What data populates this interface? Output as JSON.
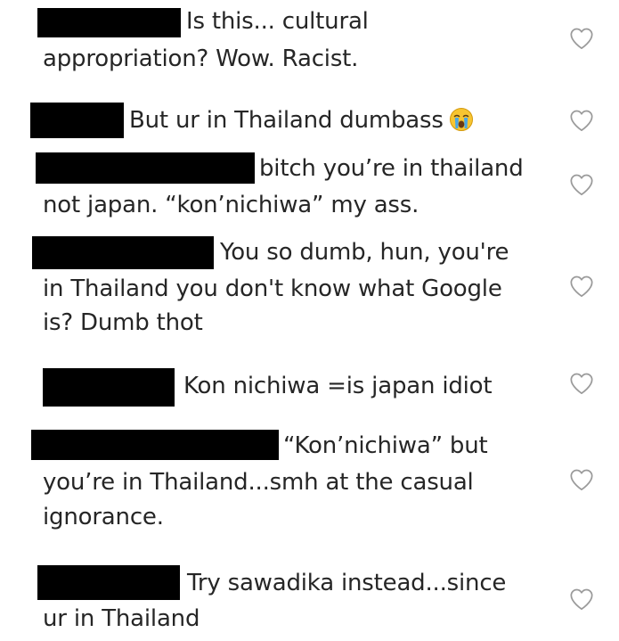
{
  "comments": [
    {
      "username": "",
      "lines": [
        "Is this... cultural",
        "appropriation? Wow. Racist."
      ]
    },
    {
      "username": "",
      "lines": [
        "But ur in Thailand dumbass"
      ],
      "emoji": "loudly-crying-face-emoji"
    },
    {
      "username": "",
      "lines": [
        "bitch you’re in thailand",
        "not japan. “kon’nichiwa” my ass."
      ]
    },
    {
      "username": "",
      "lines": [
        "You so dumb, hun, you're",
        "in Thailand you don't know what Google",
        "is? Dumb thot"
      ]
    },
    {
      "username": "",
      "lines": [
        "Kon nichiwa =is japan idiot"
      ]
    },
    {
      "username": "",
      "lines": [
        "“Kon’nichiwa” but",
        "you’re in Thailand...smh at the casual",
        "ignorance."
      ]
    },
    {
      "username": "",
      "lines": [
        "Try sawadika instead...since",
        "ur in Thailand"
      ]
    }
  ],
  "icons": {
    "like": "heart-outline-icon",
    "redaction": "black-redaction-bar"
  },
  "colors": {
    "text": "#262626",
    "background": "#ffffff",
    "icon": "#9a9a9a",
    "redaction": "#000000"
  }
}
